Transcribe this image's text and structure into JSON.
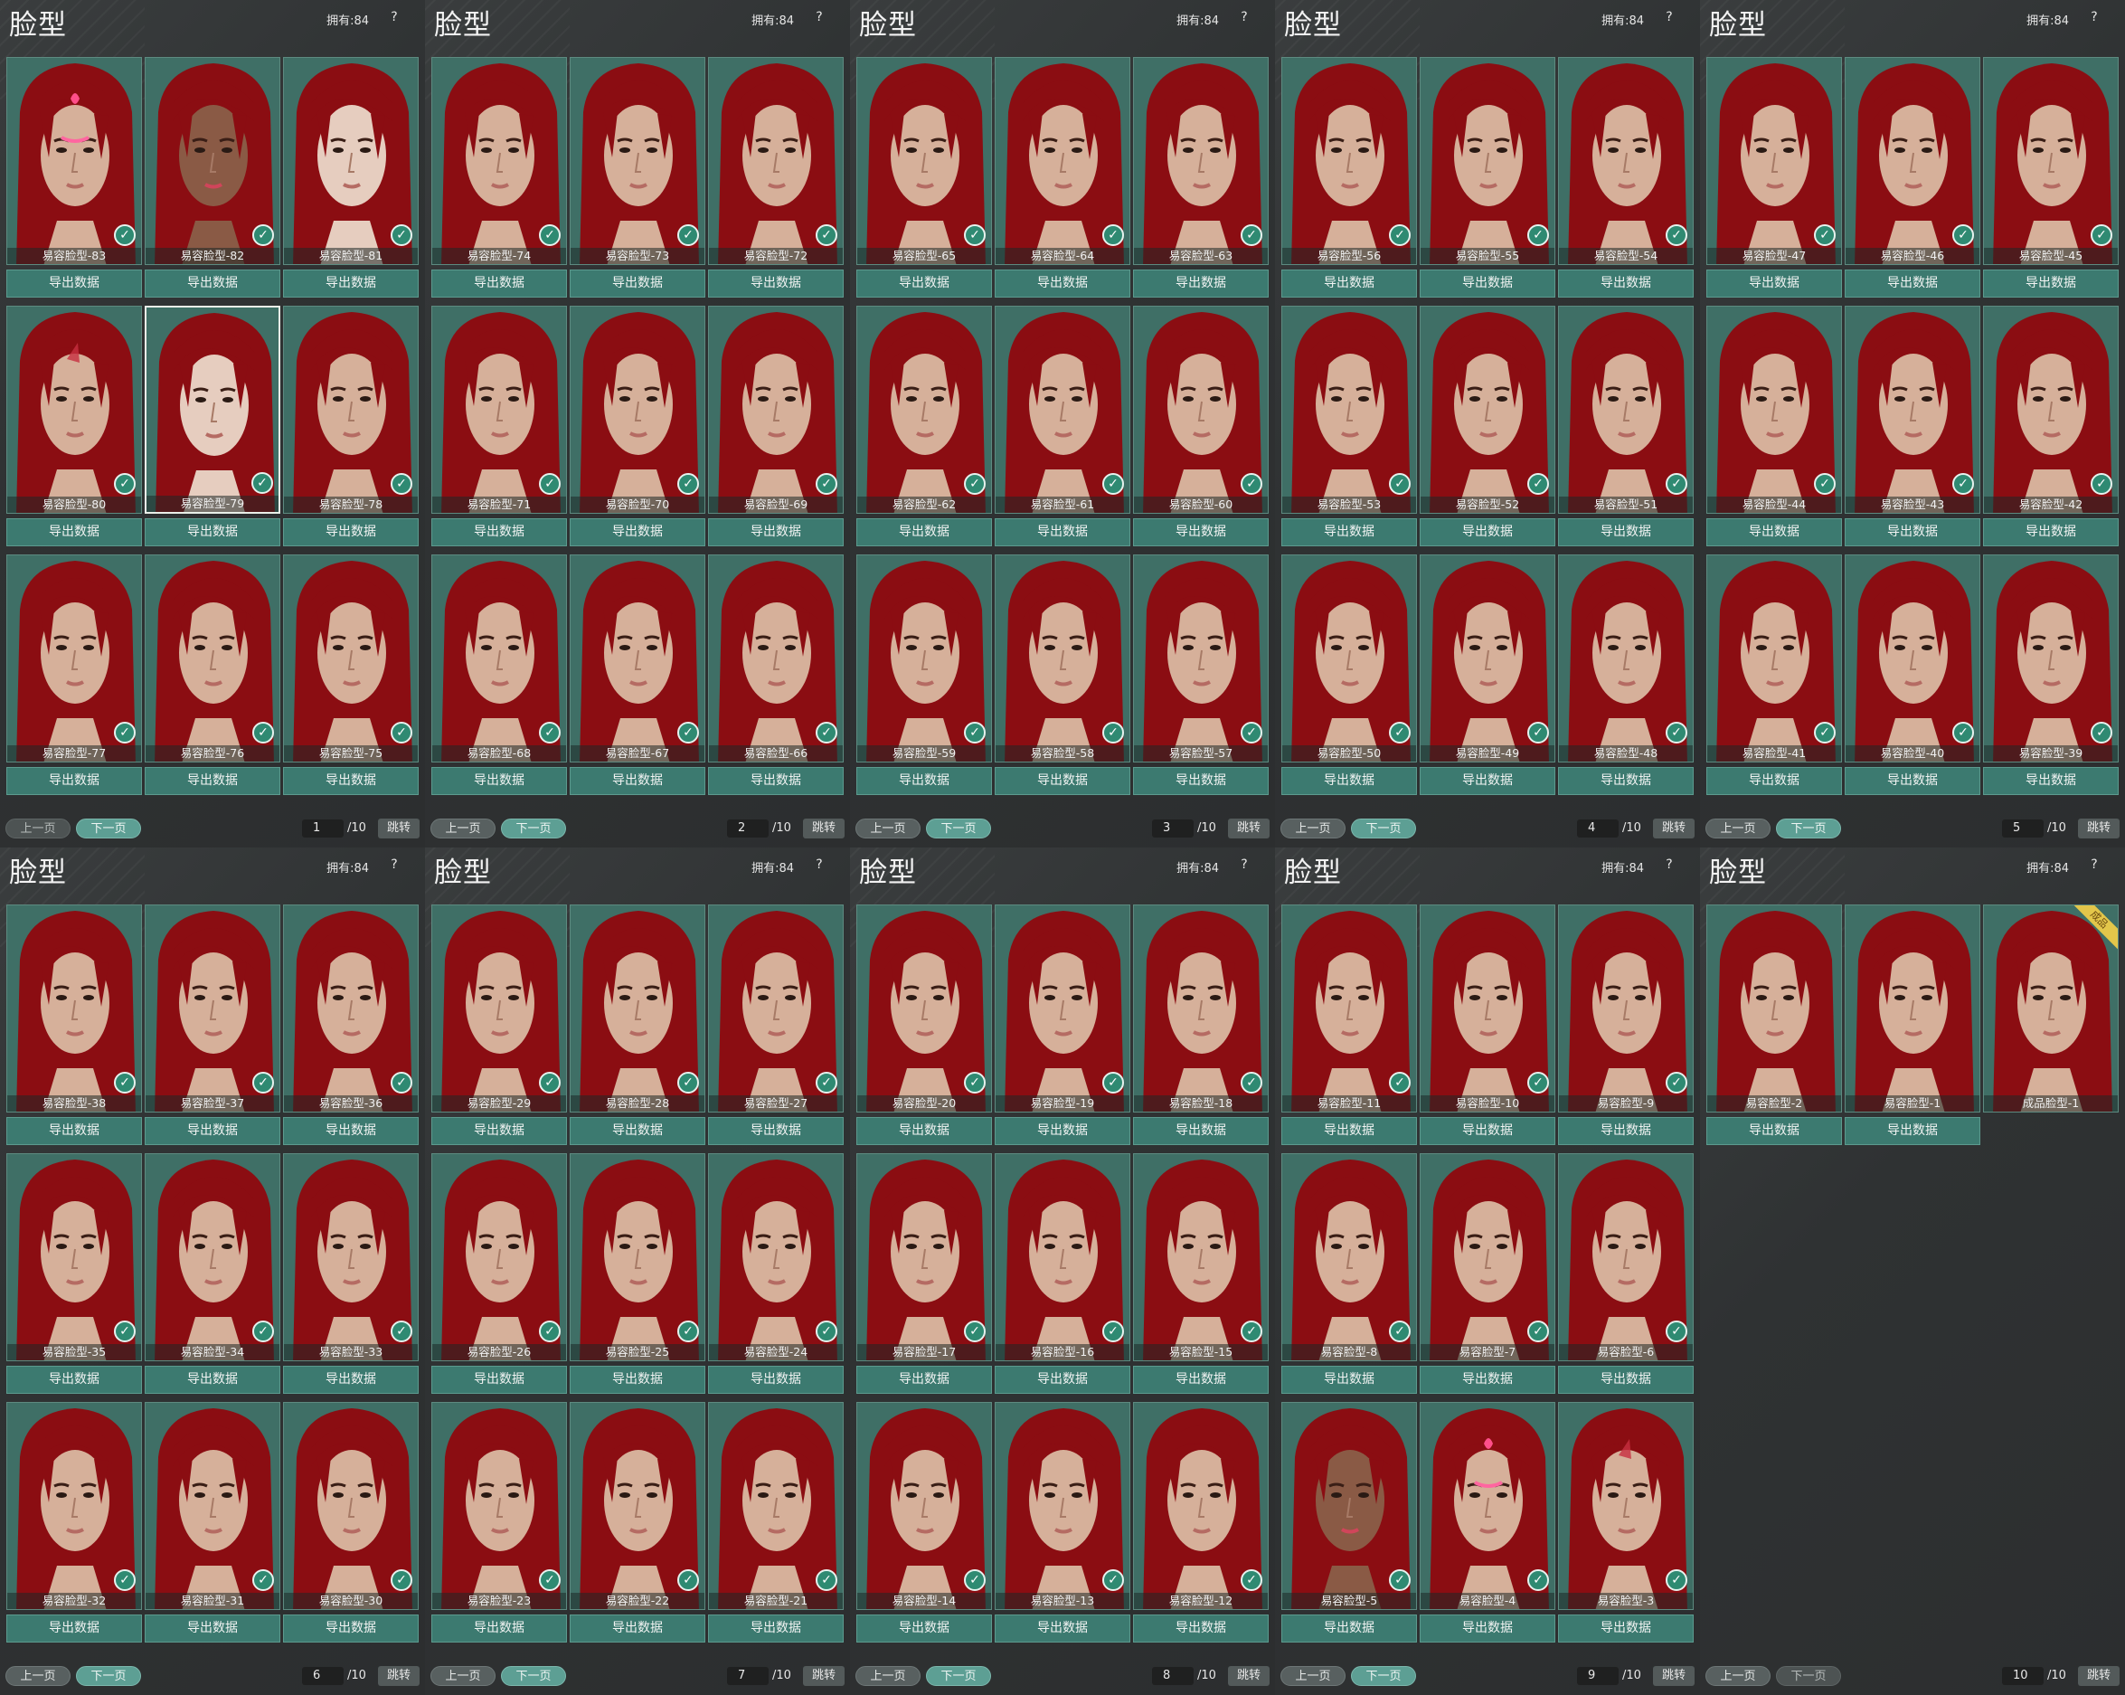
{
  "common": {
    "title": "脸型",
    "owned": "拥有:84",
    "help": "?",
    "export_label": "导出数据",
    "prev_label": "上一页",
    "next_label": "下一页",
    "jump_label": "跳转",
    "total_pages": "/10",
    "check_glyph": "✓"
  },
  "colors": {
    "card_bg": "#3f6f66",
    "hair": "#8b0d12",
    "skin": "#d6b09a",
    "export_bg": "#3c7a70",
    "accent": "#5d9f94"
  },
  "panels": [
    {
      "page": "1",
      "prev_disabled": true,
      "items": [
        {
          "name": "易容脸型-83",
          "export": true,
          "check": true,
          "variant": "mark-pink"
        },
        {
          "name": "易容脸型-82",
          "export": true,
          "check": true,
          "variant": "dark"
        },
        {
          "name": "易容脸型-81",
          "export": true,
          "check": true,
          "variant": "pale"
        },
        {
          "name": "易容脸型-80",
          "export": true,
          "check": true,
          "variant": "mark"
        },
        {
          "name": "易容脸型-79",
          "export": true,
          "check": true,
          "variant": "pale",
          "selected": true
        },
        {
          "name": "易容脸型-78",
          "export": true,
          "check": true
        },
        {
          "name": "易容脸型-77",
          "export": true,
          "check": true
        },
        {
          "name": "易容脸型-76",
          "export": true,
          "check": true
        },
        {
          "name": "易容脸型-75",
          "export": true,
          "check": true
        }
      ]
    },
    {
      "page": "2",
      "items": [
        {
          "name": "易容脸型-74",
          "export": true,
          "check": true
        },
        {
          "name": "易容脸型-73",
          "export": true,
          "check": true
        },
        {
          "name": "易容脸型-72",
          "export": true,
          "check": true
        },
        {
          "name": "易容脸型-71",
          "export": true,
          "check": true
        },
        {
          "name": "易容脸型-70",
          "export": true,
          "check": true
        },
        {
          "name": "易容脸型-69",
          "export": true,
          "check": true
        },
        {
          "name": "易容脸型-68",
          "export": true,
          "check": true
        },
        {
          "name": "易容脸型-67",
          "export": true,
          "check": true
        },
        {
          "name": "易容脸型-66",
          "export": true,
          "check": true
        }
      ]
    },
    {
      "page": "3",
      "items": [
        {
          "name": "易容脸型-65",
          "export": true,
          "check": true
        },
        {
          "name": "易容脸型-64",
          "export": true,
          "check": true
        },
        {
          "name": "易容脸型-63",
          "export": true,
          "check": true
        },
        {
          "name": "易容脸型-62",
          "export": true,
          "check": true
        },
        {
          "name": "易容脸型-61",
          "export": true,
          "check": true
        },
        {
          "name": "易容脸型-60",
          "export": true,
          "check": true
        },
        {
          "name": "易容脸型-59",
          "export": true,
          "check": true
        },
        {
          "name": "易容脸型-58",
          "export": true,
          "check": true
        },
        {
          "name": "易容脸型-57",
          "export": true,
          "check": true
        }
      ]
    },
    {
      "page": "4",
      "items": [
        {
          "name": "易容脸型-56",
          "export": true,
          "check": true
        },
        {
          "name": "易容脸型-55",
          "export": true,
          "check": true
        },
        {
          "name": "易容脸型-54",
          "export": true,
          "check": true
        },
        {
          "name": "易容脸型-53",
          "export": true,
          "check": true
        },
        {
          "name": "易容脸型-52",
          "export": true,
          "check": true
        },
        {
          "name": "易容脸型-51",
          "export": true,
          "check": true
        },
        {
          "name": "易容脸型-50",
          "export": true,
          "check": true
        },
        {
          "name": "易容脸型-49",
          "export": true,
          "check": true
        },
        {
          "name": "易容脸型-48",
          "export": true,
          "check": true
        }
      ]
    },
    {
      "page": "5",
      "items": [
        {
          "name": "易容脸型-47",
          "export": true,
          "check": true
        },
        {
          "name": "易容脸型-46",
          "export": true,
          "check": true
        },
        {
          "name": "易容脸型-45",
          "export": true,
          "check": true
        },
        {
          "name": "易容脸型-44",
          "export": true,
          "check": true
        },
        {
          "name": "易容脸型-43",
          "export": true,
          "check": true
        },
        {
          "name": "易容脸型-42",
          "export": true,
          "check": true
        },
        {
          "name": "易容脸型-41",
          "export": true,
          "check": true
        },
        {
          "name": "易容脸型-40",
          "export": true,
          "check": true
        },
        {
          "name": "易容脸型-39",
          "export": true,
          "check": true
        }
      ]
    },
    {
      "page": "6",
      "items": [
        {
          "name": "易容脸型-38",
          "export": true,
          "check": true
        },
        {
          "name": "易容脸型-37",
          "export": true,
          "check": true
        },
        {
          "name": "易容脸型-36",
          "export": true,
          "check": true
        },
        {
          "name": "易容脸型-35",
          "export": true,
          "check": true
        },
        {
          "name": "易容脸型-34",
          "export": true,
          "check": true
        },
        {
          "name": "易容脸型-33",
          "export": true,
          "check": true
        },
        {
          "name": "易容脸型-32",
          "export": true,
          "check": true
        },
        {
          "name": "易容脸型-31",
          "export": true,
          "check": true
        },
        {
          "name": "易容脸型-30",
          "export": true,
          "check": true
        }
      ]
    },
    {
      "page": "7",
      "items": [
        {
          "name": "易容脸型-29",
          "export": true,
          "check": true
        },
        {
          "name": "易容脸型-28",
          "export": true,
          "check": true
        },
        {
          "name": "易容脸型-27",
          "export": true,
          "check": true
        },
        {
          "name": "易容脸型-26",
          "export": true,
          "check": true
        },
        {
          "name": "易容脸型-25",
          "export": true,
          "check": true
        },
        {
          "name": "易容脸型-24",
          "export": true,
          "check": true
        },
        {
          "name": "易容脸型-23",
          "export": true,
          "check": true
        },
        {
          "name": "易容脸型-22",
          "export": true,
          "check": true
        },
        {
          "name": "易容脸型-21",
          "export": true,
          "check": true
        }
      ]
    },
    {
      "page": "8",
      "items": [
        {
          "name": "易容脸型-20",
          "export": true,
          "check": true
        },
        {
          "name": "易容脸型-19",
          "export": true,
          "check": true
        },
        {
          "name": "易容脸型-18",
          "export": true,
          "check": true
        },
        {
          "name": "易容脸型-17",
          "export": true,
          "check": true
        },
        {
          "name": "易容脸型-16",
          "export": true,
          "check": true
        },
        {
          "name": "易容脸型-15",
          "export": true,
          "check": true
        },
        {
          "name": "易容脸型-14",
          "export": true,
          "check": true
        },
        {
          "name": "易容脸型-13",
          "export": true,
          "check": true
        },
        {
          "name": "易容脸型-12",
          "export": true,
          "check": true
        }
      ]
    },
    {
      "page": "9",
      "items": [
        {
          "name": "易容脸型-11",
          "export": true,
          "check": true
        },
        {
          "name": "易容脸型-10",
          "export": true,
          "check": true
        },
        {
          "name": "易容脸型-9",
          "export": true,
          "check": true
        },
        {
          "name": "易容脸型-8",
          "export": true,
          "check": true
        },
        {
          "name": "易容脸型-7",
          "export": true,
          "check": true
        },
        {
          "name": "易容脸型-6",
          "export": true,
          "check": true
        },
        {
          "name": "易容脸型-5",
          "export": true,
          "check": true,
          "variant": "dark"
        },
        {
          "name": "易容脸型-4",
          "export": true,
          "check": true,
          "variant": "mark-pink"
        },
        {
          "name": "易容脸型-3",
          "export": true,
          "check": true,
          "variant": "mark"
        }
      ]
    },
    {
      "page": "10",
      "next_disabled": true,
      "items": [
        {
          "name": "易容脸型-2",
          "export": true,
          "check": false
        },
        {
          "name": "易容脸型-1",
          "export": true,
          "check": false
        },
        {
          "name": "成品脸型-1",
          "export": false,
          "check": false,
          "badge": "成品"
        }
      ]
    }
  ]
}
